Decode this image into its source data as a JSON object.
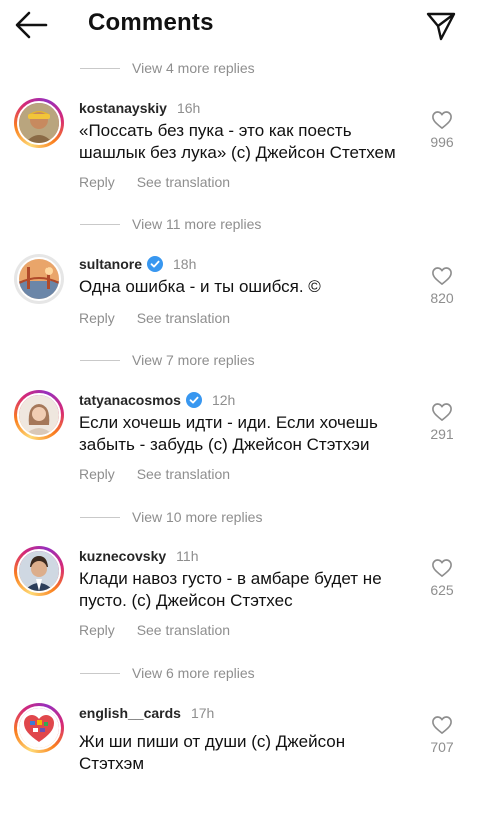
{
  "header": {
    "title": "Comments",
    "back_icon": "arrow-left-icon",
    "share_icon": "paper-plane-icon"
  },
  "thread": [
    {
      "view_more": "View 4 more replies",
      "comment": {
        "username": "kostanayskiy",
        "verified": false,
        "time": "16h",
        "text": "«Поссать без пука - это как поесть шашлык без лука» (с) Джейсон Стетхем",
        "reply_label": "Reply",
        "translate_label": "See translation",
        "likes": "996"
      }
    },
    {
      "view_more": "View 11 more replies",
      "comment": {
        "username": "sultanore",
        "verified": true,
        "time": "18h",
        "text": "Одна ошибка - и ты ошибся. ©",
        "reply_label": "Reply",
        "translate_label": "See translation",
        "likes": "820"
      }
    },
    {
      "view_more": "View 7 more replies",
      "comment": {
        "username": "tatyanacosmos",
        "verified": true,
        "time": "12h",
        "text": "Если хочешь идти - иди. Если хочешь забыть - забудь (с) Джейсон Стэтхэи",
        "reply_label": "Reply",
        "translate_label": "See translation",
        "likes": "291"
      }
    },
    {
      "view_more": "View 10 more replies",
      "comment": {
        "username": "kuznecovsky",
        "verified": false,
        "time": "11h",
        "text": "Клади навоз густо - в амбаре будет не пусто. (с) Джейсон Стэтхес",
        "reply_label": "Reply",
        "translate_label": "See translation",
        "likes": "625"
      }
    },
    {
      "view_more": "View 6 more replies",
      "comment": {
        "username": "english__cards",
        "verified": false,
        "time": "17h",
        "text": "Жи ши пиши от души (с) Джейсон Стэтхэм",
        "likes": "707"
      }
    }
  ],
  "colors": {
    "text": "#111111",
    "secondary": "#8e8e8e",
    "verified": "#3897f0",
    "divider": "#c9c9c9"
  }
}
